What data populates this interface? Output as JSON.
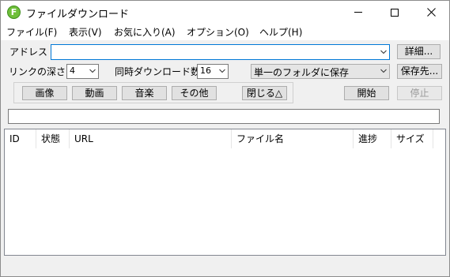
{
  "window": {
    "title": "ファイルダウンロード",
    "icon_letter": "F"
  },
  "menu": [
    "ファイル(F)",
    "表示(V)",
    "お気に入り(A)",
    "オプション(O)",
    "ヘルプ(H)"
  ],
  "address": {
    "label": "アドレス",
    "value": ""
  },
  "detail_button": "詳細...",
  "link_depth": {
    "label": "リンクの深さ",
    "value": "4"
  },
  "concurrent": {
    "label": "同時ダウンロード数",
    "value": "16"
  },
  "save_mode": {
    "value": "単一のフォルダに保存"
  },
  "save_to_button": "保存先...",
  "filter_buttons": [
    "画像",
    "動画",
    "音楽",
    "その他"
  ],
  "close_button": "閉じる△",
  "start_button": "開始",
  "stop_button": "停止",
  "filter_text": "",
  "columns": [
    "ID",
    "状態",
    "URL",
    "ファイル名",
    "進捗",
    "サイズ"
  ],
  "colors": {
    "accent": "#0078d7",
    "icon_green": "#6fbf3a"
  },
  "icons": [
    "app-icon",
    "minimize-icon",
    "maximize-icon",
    "close-icon",
    "chevron-down-icon"
  ]
}
